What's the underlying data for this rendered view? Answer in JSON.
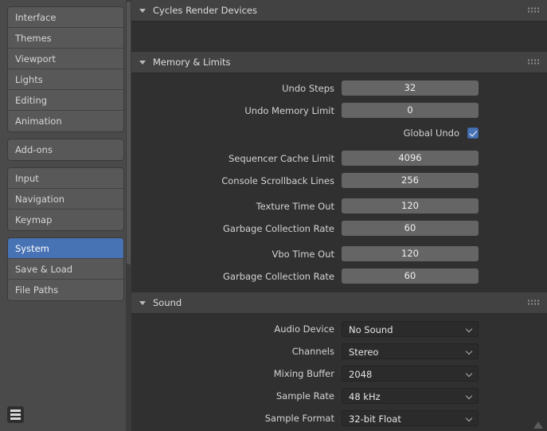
{
  "sidebar": {
    "groups": [
      {
        "items": [
          {
            "label": "Interface",
            "selected": false
          },
          {
            "label": "Themes",
            "selected": false
          },
          {
            "label": "Viewport",
            "selected": false
          },
          {
            "label": "Lights",
            "selected": false
          },
          {
            "label": "Editing",
            "selected": false
          },
          {
            "label": "Animation",
            "selected": false
          }
        ]
      },
      {
        "items": [
          {
            "label": "Add-ons",
            "selected": false
          }
        ]
      },
      {
        "items": [
          {
            "label": "Input",
            "selected": false
          },
          {
            "label": "Navigation",
            "selected": false
          },
          {
            "label": "Keymap",
            "selected": false
          }
        ]
      },
      {
        "items": [
          {
            "label": "System",
            "selected": true
          },
          {
            "label": "Save & Load",
            "selected": false
          },
          {
            "label": "File Paths",
            "selected": false
          }
        ]
      }
    ],
    "menu_icon": "hamburger-menu-icon"
  },
  "panels": {
    "cycles": {
      "title": "Cycles Render Devices",
      "expanded": true
    },
    "memory": {
      "title": "Memory & Limits",
      "expanded": true
    },
    "sound": {
      "title": "Sound",
      "expanded": true
    }
  },
  "memory_fields": {
    "undo_steps": {
      "label": "Undo Steps",
      "value": "32"
    },
    "undo_memory_limit": {
      "label": "Undo Memory Limit",
      "value": "0"
    },
    "global_undo": {
      "label": "Global Undo",
      "checked": true
    },
    "sequencer_cache_limit": {
      "label": "Sequencer Cache Limit",
      "value": "4096"
    },
    "console_scrollback_lines": {
      "label": "Console Scrollback Lines",
      "value": "256"
    },
    "texture_time_out": {
      "label": "Texture Time Out",
      "value": "120"
    },
    "texture_gc_rate": {
      "label": "Garbage Collection Rate",
      "value": "60"
    },
    "vbo_time_out": {
      "label": "Vbo Time Out",
      "value": "120"
    },
    "vbo_gc_rate": {
      "label": "Garbage Collection Rate",
      "value": "60"
    }
  },
  "sound_fields": {
    "audio_device": {
      "label": "Audio Device",
      "value": "No Sound"
    },
    "channels": {
      "label": "Channels",
      "value": "Stereo"
    },
    "mixing_buffer": {
      "label": "Mixing Buffer",
      "value": "2048"
    },
    "sample_rate": {
      "label": "Sample Rate",
      "value": "48 kHz"
    },
    "sample_format": {
      "label": "Sample Format",
      "value": "32-bit Float"
    }
  },
  "colors": {
    "accent": "#4772b3",
    "sidebar_bg": "#4a4a4a",
    "panel_bg": "#303030",
    "panel_header_bg": "#424242",
    "field_bg": "#656565",
    "dropdown_bg": "#2b2b2b"
  }
}
